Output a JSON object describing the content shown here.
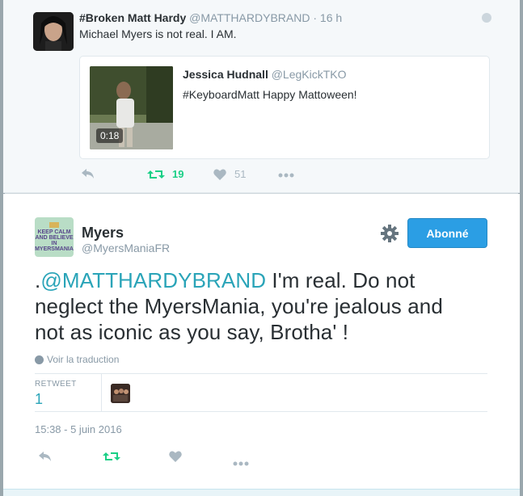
{
  "parent_tweet": {
    "author_name": "#Broken Matt Hardy",
    "handle": "@MATTHARDYBRAND",
    "separator": "·",
    "time": "16 h",
    "text": "Michael Myers is not real. I AM.",
    "quoted": {
      "author_name": "Jessica Hudnall",
      "handle": "@LegKickTKO",
      "text": "#KeyboardMatt Happy Mattoween!",
      "video_duration": "0:18"
    },
    "actions": {
      "retweet_count": "19",
      "like_count": "51"
    }
  },
  "main_tweet": {
    "author_name": "Myers",
    "handle": "@MyersManiaFR",
    "avatar_text": "KEEP CALM AND BELIEVE IN MYERSMANIA",
    "follow_button_label": "Abonné",
    "text_prefix": ".",
    "mention": "@MATTHARDYBRAND",
    "text_rest": " I'm real. Do not neglect the MyersMania, you're jealous and not as iconic as you say, Brotha' !",
    "translate_label": "Voir la traduction",
    "stats": {
      "retweet_label": "RETWEET",
      "retweet_count": "1"
    },
    "timestamp": "15:38 - 5 juin 2016"
  },
  "colors": {
    "accent_blue": "#2b9ee4",
    "mention_teal": "#2aa4b8",
    "retweet_green": "#19cf86",
    "muted_gray": "#8899a6"
  },
  "icons": [
    "reply-icon",
    "retweet-icon",
    "heart-icon",
    "more-icon",
    "globe-icon",
    "gear-icon"
  ]
}
